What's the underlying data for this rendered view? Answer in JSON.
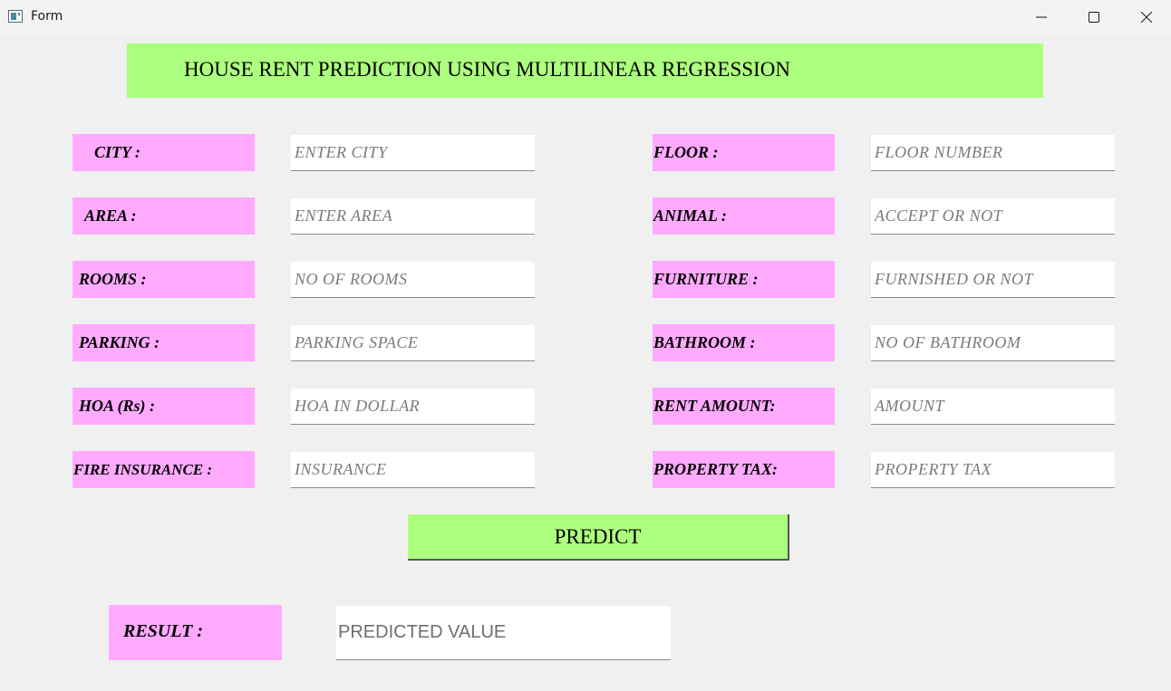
{
  "window": {
    "title": "Form",
    "icon": "app-form-icon",
    "controls": [
      "minimize-icon",
      "maximize-icon",
      "close-icon"
    ]
  },
  "header": {
    "title": "HOUSE RENT PREDICTION USING MULTILINEAR REGRESSION",
    "background": "#adff7f"
  },
  "colors": {
    "label_background": "#ffaaff",
    "button_background": "#adff7f",
    "window_background": "#f0f0f0"
  },
  "left_fields": [
    {
      "label": "CITY :",
      "placeholder": "ENTER CITY",
      "value": ""
    },
    {
      "label": "AREA :",
      "placeholder": "ENTER AREA",
      "value": ""
    },
    {
      "label": "ROOMS :",
      "placeholder": "NO OF ROOMS",
      "value": ""
    },
    {
      "label": "PARKING :",
      "placeholder": "PARKING SPACE",
      "value": ""
    },
    {
      "label": "HOA (Rs) :",
      "placeholder": "HOA IN DOLLAR",
      "value": ""
    },
    {
      "label": "FIRE INSURANCE :",
      "placeholder": "INSURANCE",
      "value": ""
    }
  ],
  "right_fields": [
    {
      "label": "FLOOR :",
      "placeholder": "FLOOR NUMBER",
      "value": ""
    },
    {
      "label": "ANIMAL :",
      "placeholder": "ACCEPT OR NOT",
      "value": ""
    },
    {
      "label": "FURNITURE :",
      "placeholder": "FURNISHED OR NOT",
      "value": ""
    },
    {
      "label": "BATHROOM :",
      "placeholder": "NO OF BATHROOM",
      "value": ""
    },
    {
      "label": "RENT AMOUNT:",
      "placeholder": "AMOUNT",
      "value": ""
    },
    {
      "label": "PROPERTY TAX:",
      "placeholder": "PROPERTY TAX",
      "value": ""
    }
  ],
  "predict_button": {
    "label": "PREDICT"
  },
  "result": {
    "label": "RESULT :",
    "placeholder": "PREDICTED VALUE",
    "value": ""
  }
}
